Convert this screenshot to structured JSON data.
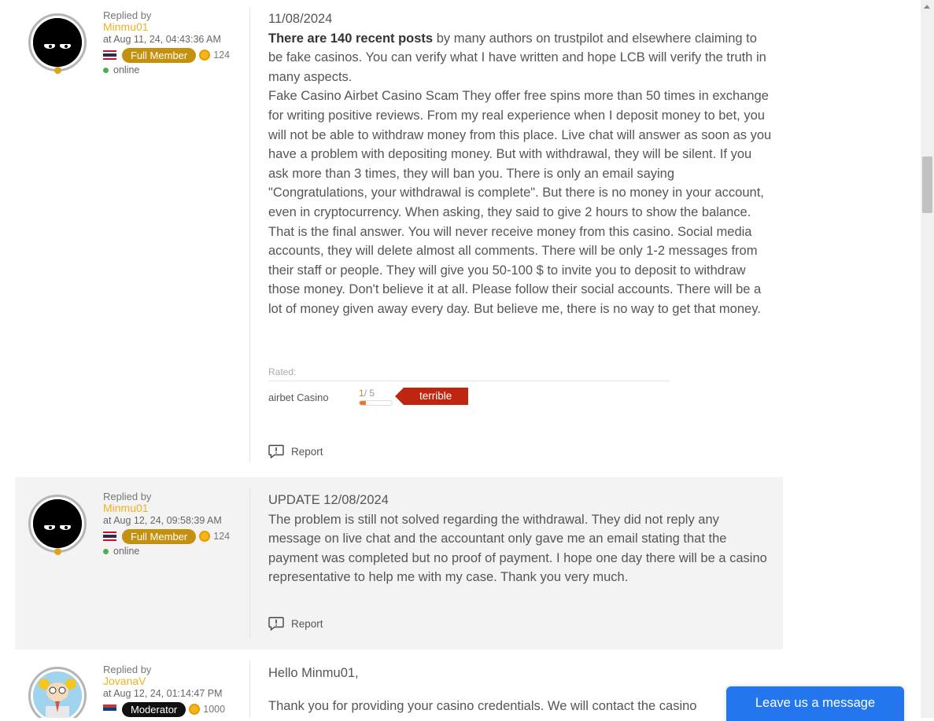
{
  "posts": [
    {
      "replied_label": "Replied by",
      "username": "Minmu01",
      "timestamp": "at Aug 11, 24, 04:43:36 AM",
      "rank": "Full Member",
      "points": "124",
      "status": "online",
      "paragraphs": [
        {
          "date": "11/08/2024"
        },
        {
          "bold": "There are 140 recent posts",
          "rest": " by many authors on trustpilot and elsewhere claiming to be fake casinos. You can verify what I have written and hope LCB will verify the truth in many aspects."
        },
        {
          "text": "Fake Casino Airbet Casino Scam They offer free spins more than 50 times in exchange for writing positive reviews. From my real experience when I deposit money to bet, you will not be able to withdraw money from this place. Live chat will answer as soon as you have a problem with depositing money. But with withdrawal, they will be silent. If you ask more than 3 times, they will ban you. There is only an email saying \"Congratulations, your withdrawal is complete\". But there is no money in your account, even in cryptocurrency. When asking, they said to give 2 hours to show the balance. That is the final answer. You will never receive money from this casino. Social media accounts, they will delete almost all comments. There will be only 1-2 messages from their staff or people. They will give you 50-100 $ to invite you to deposit to withdraw those money. Don't believe it at all. Please follow their social accounts. There will be a lot of money given away every day. But believe me, there is no way to get that money."
        }
      ],
      "rated": {
        "label": "Rated:",
        "casino": "airbet Casino",
        "score": "1",
        "score_max": "/ 5",
        "score_fraction": 0.2,
        "verdict": "terrible"
      },
      "report": "Report"
    },
    {
      "replied_label": "Replied by",
      "username": "Minmu01",
      "timestamp": "at Aug 12, 24, 09:58:39 AM",
      "rank": "Full Member",
      "points": "124",
      "status": "online",
      "date_line": "UPDATE 12/08/2024",
      "text": "The problem is still not solved regarding the withdrawal. They did not reply any message on live chat and the accountant only gave me an email stating that the payment was completed but no proof of payment. I hope one day there will be a casino representative to help me with my case. Thank you very much.",
      "report": "Report"
    },
    {
      "replied_label": "Replied by",
      "username": "JovanaV",
      "timestamp": "at Aug 12, 24, 01:14:47 PM",
      "rank": "Moderator",
      "points": "1000",
      "greeting": "Hello Minmu01,",
      "text": "Thank you for providing your casino credentials. We will contact the casino"
    }
  ],
  "chat_widget": {
    "label": "Leave us a message"
  },
  "colors": {
    "username": "#f0b11d",
    "member_badge": "#c4900f",
    "moderator_badge": "#111111",
    "verdict": "#c0260f",
    "chat": "#2476ef"
  }
}
